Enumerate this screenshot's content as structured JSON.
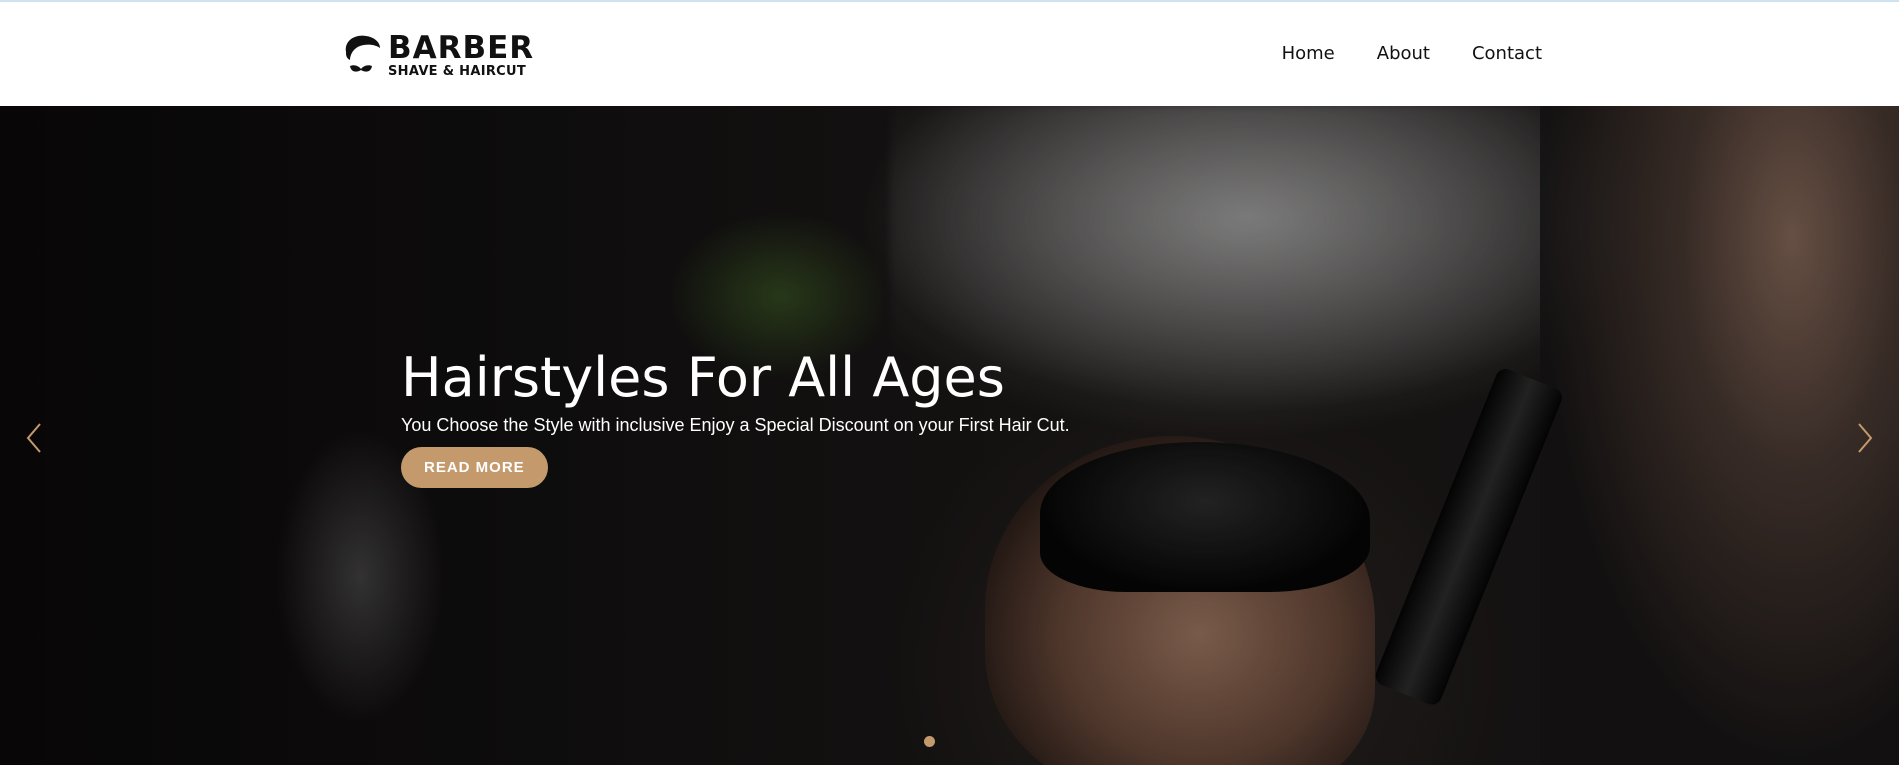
{
  "header": {
    "logo": {
      "title": "BARBER",
      "subtitle": "SHAVE & HAIRCUT",
      "icon": "barber-mustache-icon"
    },
    "nav": [
      {
        "label": "Home"
      },
      {
        "label": "About"
      },
      {
        "label": "Contact"
      }
    ]
  },
  "hero": {
    "title": "Hairstyles For All Ages",
    "subtitle": "You Choose the Style with inclusive Enjoy a Special Discount on your First Hair Cut.",
    "button_label": "READ MORE",
    "prev_icon": "chevron-left-icon",
    "next_icon": "chevron-right-icon",
    "slides": 1,
    "active_slide": 1
  },
  "colors": {
    "accent": "#c49a6c",
    "header_bg": "#ffffff",
    "text_dark": "#111111"
  }
}
